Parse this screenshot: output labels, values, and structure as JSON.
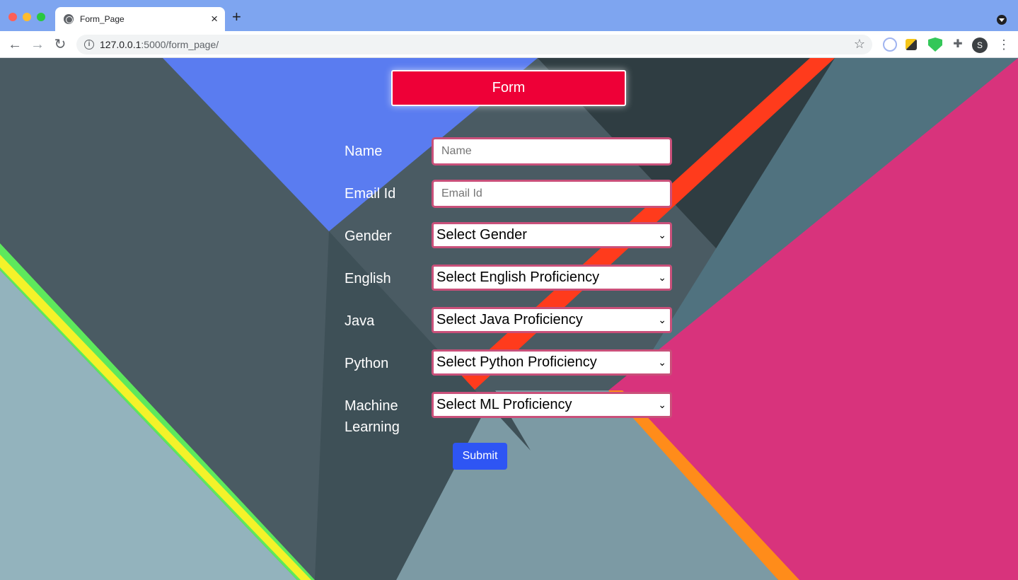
{
  "browser": {
    "tab_title": "Form_Page",
    "tab_close": "×",
    "new_tab": "+",
    "url_host": "127.0.0.1",
    "url_path": ":5000/form_page/",
    "avatar_letter": "S",
    "icons": [
      "globe-icon",
      "back-icon",
      "forward-icon",
      "reload-icon",
      "info-icon",
      "star-icon",
      "extension-icon",
      "avatar",
      "menu-icon"
    ]
  },
  "form": {
    "banner": "Form",
    "fields": {
      "name": {
        "label": "Name",
        "placeholder": "Name"
      },
      "email": {
        "label": "Email Id",
        "placeholder": "Email Id"
      },
      "gender": {
        "label": "Gender",
        "value": "Select Gender"
      },
      "english": {
        "label": "English",
        "value": "Select English Proficiency"
      },
      "java": {
        "label": "Java",
        "value": "Select Java Proficiency"
      },
      "python": {
        "label": "Python",
        "value": "Select Python Proficiency"
      },
      "ml": {
        "label_line1": "Machine",
        "label_line2": "Learning",
        "value": "Select ML Proficiency"
      }
    },
    "submit_label": "Submit"
  },
  "colors": {
    "banner": "#ee0037",
    "field_border": "#c9507a",
    "submit": "#2e55f4",
    "tab_strip": "#7ea5f0"
  }
}
